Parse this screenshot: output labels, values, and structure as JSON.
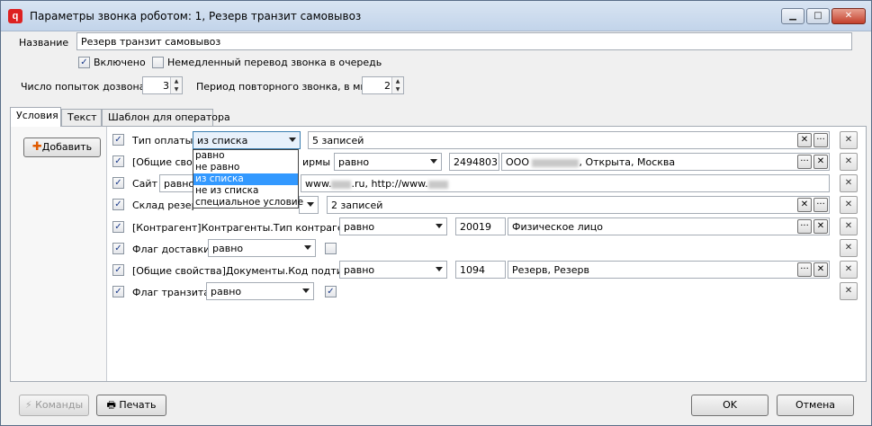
{
  "window": {
    "title": "Параметры звонка роботом: 1, Резерв транзит самовывоз",
    "app_icon": "q",
    "min": "▁",
    "max": "□",
    "close": "✕"
  },
  "form": {
    "name_label": "Название",
    "name_value": "Резерв транзит самовывоз",
    "enabled_label": "Включено",
    "enabled_checked": "✓",
    "immediate_label": "Немедленный перевод звонка в очередь",
    "attempts_label": "Число попыток дозвона",
    "attempts_value": "3",
    "period_label": "Период повторного звонка, в мин",
    "period_value": "2"
  },
  "tabs": [
    "Условия",
    "Текст",
    "Шаблон для оператора"
  ],
  "add_button": "Добавить",
  "conditions": [
    {
      "label": "Тип оплаты",
      "op": "из списка",
      "value": "5 записей",
      "checked": "✓"
    },
    {
      "label": "[Общие свой",
      "label_tail": "ирмы",
      "op": "равно",
      "code": "2494803",
      "value_prefix": "ООО",
      "value_suffix": ", Открыта, Москва",
      "checked": "✓"
    },
    {
      "label": "Сайт",
      "op": "равно",
      "value_prefix": "www.",
      "value_mid": ".ru, http://www.",
      "checked": "✓"
    },
    {
      "label": "Склад резерв",
      "op": "",
      "value": "2 записей",
      "checked": "✓"
    },
    {
      "label": "[Контрагент]Контрагенты.Тип контрагента",
      "op": "равно",
      "code": "20019",
      "value": "Физическое лицо",
      "checked": "✓"
    },
    {
      "label": "Флаг доставки",
      "op": "равно",
      "checked": "✓"
    },
    {
      "label": "[Общие свойства]Документы.Код подтипа",
      "op": "равно",
      "code": "1094",
      "value": "Резерв, Резерв",
      "checked": "✓"
    },
    {
      "label": "Флаг транзита",
      "op": "равно",
      "value_check": "✓",
      "checked": "✓"
    }
  ],
  "dropdown_options": [
    "равно",
    "не равно",
    "из списка",
    "не из списка",
    "специальное условие"
  ],
  "dropdown_selected": 2,
  "buttons": {
    "commands": "Команды",
    "print": "Печать",
    "ok": "OK",
    "cancel": "Отмена",
    "ellipsis": "···",
    "clear": "✕"
  }
}
